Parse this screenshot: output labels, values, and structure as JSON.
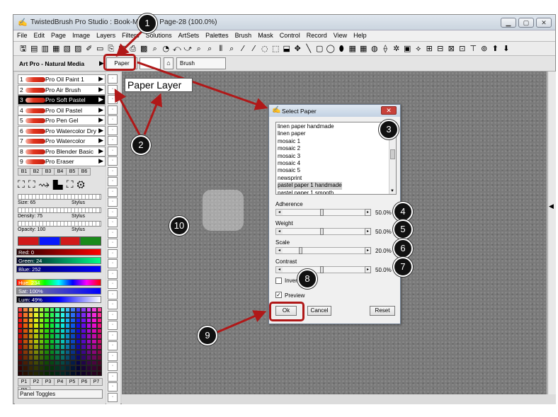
{
  "window": {
    "title": "TwistedBrush Pro Studio : Book-My First Page-28 (100.0%)"
  },
  "menu": [
    "File",
    "Edit",
    "Page",
    "Image",
    "Layers",
    "Filters",
    "Solutions",
    "ArtSets",
    "Palettes",
    "Brush",
    "Mask",
    "Control",
    "Record",
    "View",
    "Help"
  ],
  "toolbar_icons": "🖫▤▥▦▧▨✐▭⎘▣⎙▩⌕◔⤺⤻⌕⌕⫴⌕⁄⁄◌⬚⬓✥╲▢◯⬮▦▦◍⟠✲▣⟡⊞⊟⊠⊡⊤⊚⬆⬇",
  "row2": {
    "artset": "Art Pro - Natural Media",
    "paper_btn": "Paper",
    "brush_label": "Brush"
  },
  "brushes": [
    {
      "n": "1",
      "label": "Pro Oil Paint 1"
    },
    {
      "n": "2",
      "label": "Pro Air Brush"
    },
    {
      "n": "3",
      "label": "Pro Soft Pastel"
    },
    {
      "n": "4",
      "label": "Pro Oil Pastel"
    },
    {
      "n": "5",
      "label": "Pro Pen Gel"
    },
    {
      "n": "6",
      "label": "Pro Watercolor Dry"
    },
    {
      "n": "7",
      "label": "Pro Watercolor"
    },
    {
      "n": "8",
      "label": "Pro Blender Basic"
    },
    {
      "n": "9",
      "label": "Pro Eraser"
    }
  ],
  "brush_tabs": [
    "B1",
    "B2",
    "B3",
    "B4",
    "B5",
    "B6"
  ],
  "brush_controls": {
    "size": "Size: 65",
    "density": "Density: 75",
    "opacity": "Opacity: 100",
    "stylus": "Stylus"
  },
  "color": {
    "red": "Red: 0",
    "green": "Green: 24",
    "blue": "Blue: 252",
    "hue": "Hue: 234",
    "sat": "Sat: 100%",
    "lum": "Lum: 49%",
    "current": "#0818fc"
  },
  "palette_tabs": [
    "P1",
    "P2",
    "P3",
    "P4",
    "P5",
    "P6",
    "P7",
    "P8"
  ],
  "panel_toggles": "Panel Toggles",
  "annotation_label": "Paper Layer",
  "dialog": {
    "title": "Select Paper",
    "papers": [
      "linen paper handmade",
      "linen paper",
      "mosaic 1",
      "mosaic 2",
      "mosaic 3",
      "mosaic 4",
      "mosaic 5",
      "newsprint",
      "pastel paper 1 handmade",
      "pastel paper 1 smooth"
    ],
    "selected_paper": "pastel paper 1 handmade",
    "sliders": [
      {
        "label": "Adherence",
        "value": "50.0%",
        "level": 0.5
      },
      {
        "label": "Weight",
        "value": "50.0%",
        "level": 0.5
      },
      {
        "label": "Scale",
        "value": "20.0%",
        "level": 0.2
      },
      {
        "label": "Contrast",
        "value": "50.0%",
        "level": 0.5
      }
    ],
    "invert": "Invert",
    "preview": "Preview",
    "ok": "Ok",
    "cancel": "Cancel",
    "reset": "Reset"
  },
  "callouts": [
    "1",
    "2",
    "3",
    "4",
    "5",
    "6",
    "7",
    "8",
    "9",
    "10"
  ]
}
